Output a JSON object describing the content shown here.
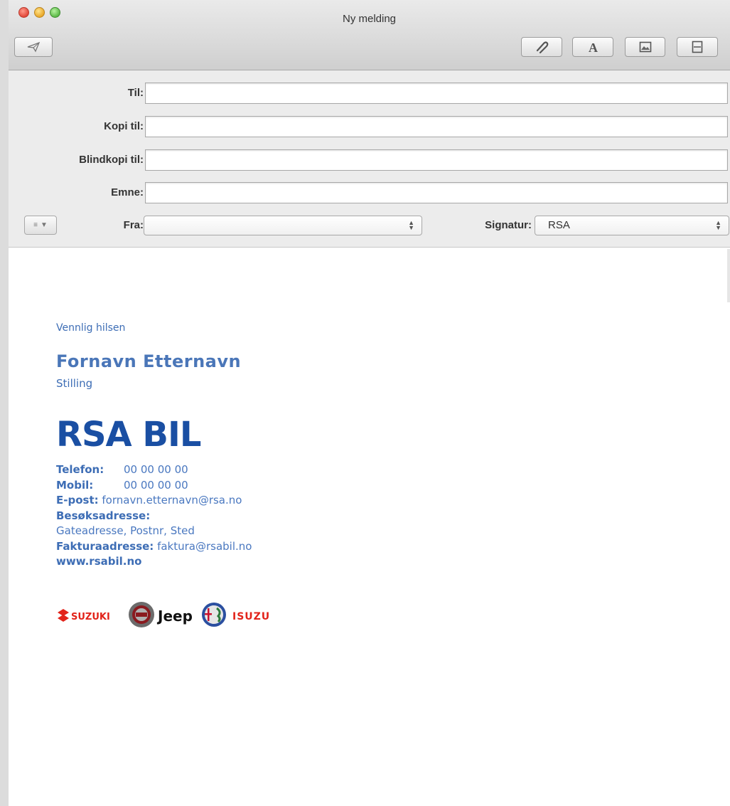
{
  "window": {
    "title": "Ny melding"
  },
  "fields": {
    "to_label": "Til:",
    "cc_label": "Kopi til:",
    "bcc_label": "Blindkopi til:",
    "subject_label": "Emne:",
    "from_label": "Fra:",
    "signature_label": "Signatur:",
    "to_value": "",
    "cc_value": "",
    "bcc_value": "",
    "subject_value": "",
    "from_value": "",
    "signature_value": "RSA"
  },
  "toolbar": {
    "icons": [
      "send-icon",
      "attach-icon",
      "font-icon",
      "photo-icon",
      "template-icon"
    ]
  },
  "signature": {
    "greeting": "Vennlig hilsen",
    "name": "Fornavn Etternavn",
    "position": "Stilling",
    "logo_text": "RSA BIL",
    "phone_label": "Telefon:",
    "phone_value": "00 00 00 00",
    "mobile_label": "Mobil:",
    "mobile_value": "00 00 00 00",
    "email_label": "E-post:",
    "email_value": "fornavn.etternavn@rsa.no",
    "visit_label": "Besøksadresse:",
    "visit_value": "Gateadresse, Postnr, Sted",
    "invoice_label": "Fakturaadresse:",
    "invoice_value": "faktura@rsabil.no",
    "website": "www.rsabil.no"
  },
  "brands": {
    "suzuki": "SUZUKI",
    "jeep": "Jeep",
    "isuzu": "ISUZU"
  },
  "colors": {
    "signature_blue": "#3d6db5",
    "logo_blue": "#1a4fa3",
    "isuzu_red": "#e2231a"
  }
}
